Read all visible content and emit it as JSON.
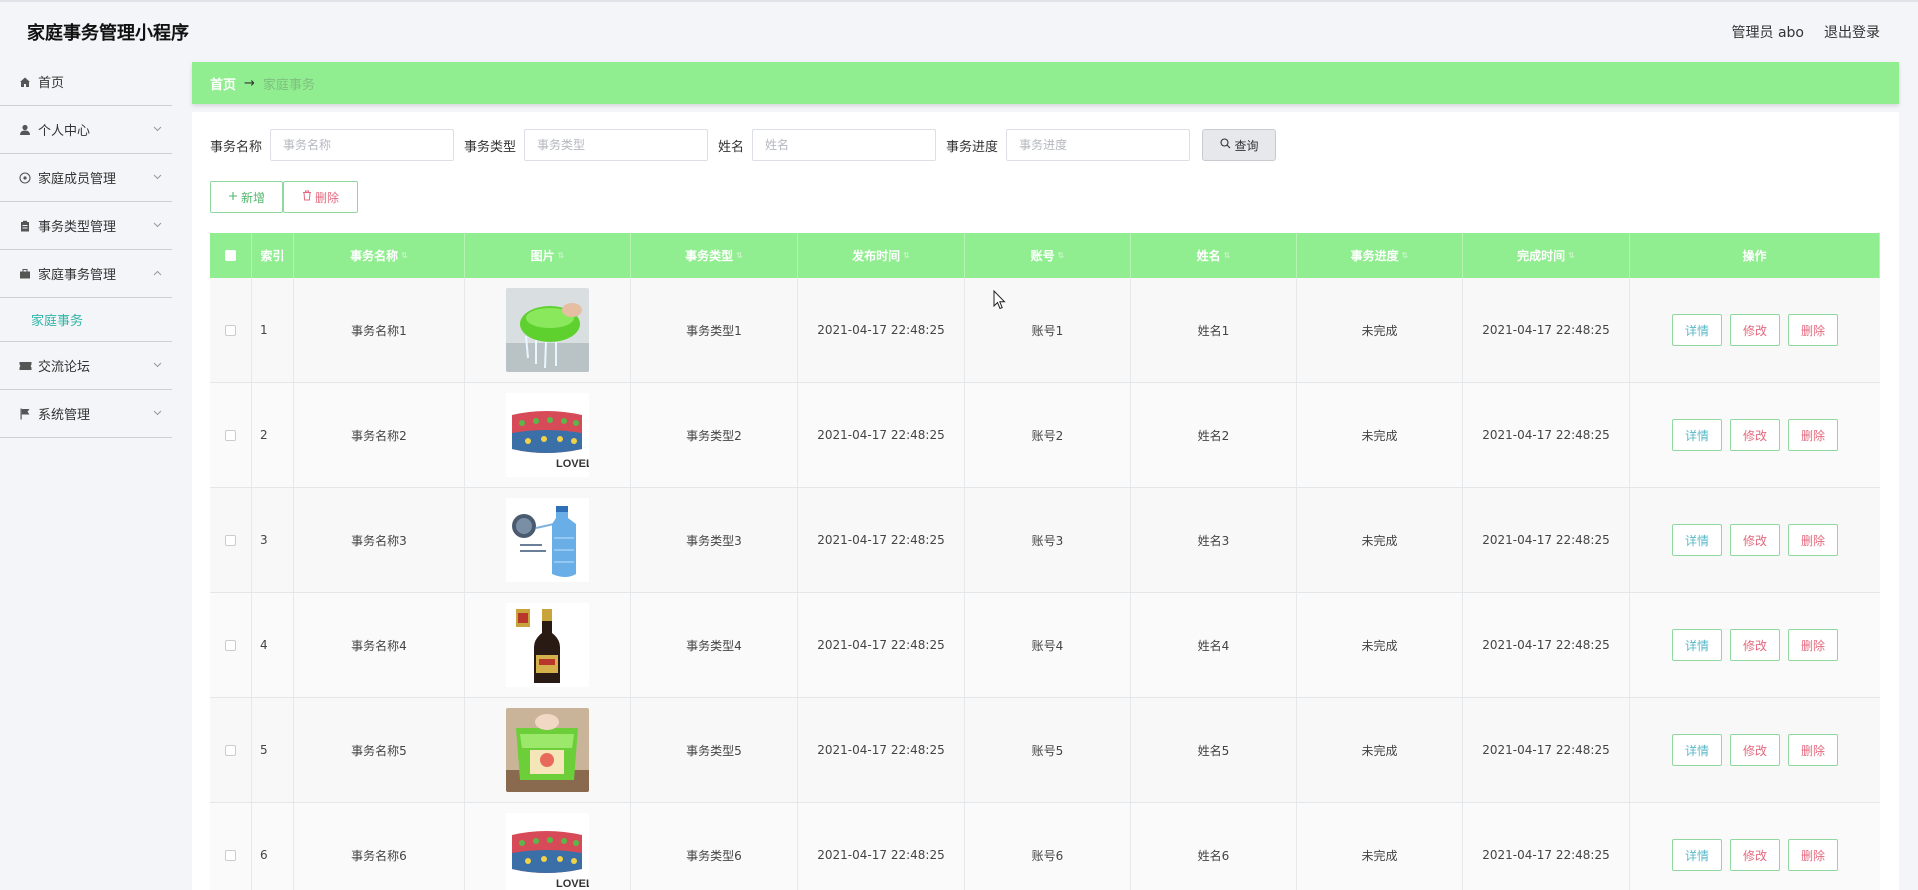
{
  "app": {
    "title": "家庭事务管理小程序"
  },
  "header": {
    "user_label": "管理员 abo",
    "logout_label": "退出登录"
  },
  "sidebar": {
    "items": [
      {
        "label": "首页",
        "icon": "home-icon"
      },
      {
        "label": "个人中心",
        "icon": "user-icon"
      },
      {
        "label": "家庭成员管理",
        "icon": "compass-icon"
      },
      {
        "label": "事务类型管理",
        "icon": "clipboard-icon"
      },
      {
        "label": "家庭事务管理",
        "icon": "briefcase-icon"
      },
      {
        "label": "交流论坛",
        "icon": "ticket-icon"
      },
      {
        "label": "系统管理",
        "icon": "flag-icon"
      }
    ],
    "submenu": {
      "label": "家庭事务"
    }
  },
  "breadcrumb": {
    "home": "首页",
    "separator": "→",
    "current": "家庭事务"
  },
  "search": {
    "fields": [
      {
        "label": "事务名称",
        "placeholder": "事务名称"
      },
      {
        "label": "事务类型",
        "placeholder": "事务类型"
      },
      {
        "label": "姓名",
        "placeholder": "姓名"
      },
      {
        "label": "事务进度",
        "placeholder": "事务进度"
      }
    ],
    "query_label": "查询"
  },
  "actions": {
    "add_label": "新增",
    "delete_label": "删除"
  },
  "table": {
    "headers": [
      "索引",
      "事务名称",
      "图片",
      "事务类型",
      "发布时间",
      "账号",
      "姓名",
      "事务进度",
      "完成时间",
      "操作"
    ],
    "rows": [
      {
        "index": "1",
        "name": "事务名称1",
        "image": "green-colander",
        "type": "事务类型1",
        "published": "2021-04-17 22:48:25",
        "account": "账号1",
        "person": "姓名1",
        "progress": "未完成",
        "completed": "2021-04-17 22:48:25"
      },
      {
        "index": "2",
        "name": "事务名称2",
        "image": "folded-towel",
        "type": "事务类型2",
        "published": "2021-04-17 22:48:25",
        "account": "账号2",
        "person": "姓名2",
        "progress": "未完成",
        "completed": "2021-04-17 22:48:25"
      },
      {
        "index": "3",
        "name": "事务名称3",
        "image": "water-jug",
        "type": "事务类型3",
        "published": "2021-04-17 22:48:25",
        "account": "账号3",
        "person": "姓名3",
        "progress": "未完成",
        "completed": "2021-04-17 22:48:25"
      },
      {
        "index": "4",
        "name": "事务名称4",
        "image": "sauce-bottle",
        "type": "事务类型4",
        "published": "2021-04-17 22:48:25",
        "account": "账号4",
        "person": "姓名4",
        "progress": "未完成",
        "completed": "2021-04-17 22:48:25"
      },
      {
        "index": "5",
        "name": "事务名称5",
        "image": "green-basket",
        "type": "事务类型5",
        "published": "2021-04-17 22:48:25",
        "account": "账号5",
        "person": "姓名5",
        "progress": "未完成",
        "completed": "2021-04-17 22:48:25"
      },
      {
        "index": "6",
        "name": "事务名称6",
        "image": "folded-towel",
        "type": "事务类型6",
        "published": "2021-04-17 22:48:25",
        "account": "账号6",
        "person": "姓名6",
        "progress": "未完成",
        "completed": "2021-04-17 22:48:25"
      }
    ],
    "row_actions": {
      "detail": "详情",
      "edit": "修改",
      "delete": "删除"
    }
  },
  "images": {
    "towel_brand": "LOVEL"
  },
  "colors": {
    "accent_green": "#90ee90",
    "submenu_teal": "#2fb6a6",
    "delete_red": "#e36a7e",
    "detail_blue": "#5ab8c8"
  }
}
